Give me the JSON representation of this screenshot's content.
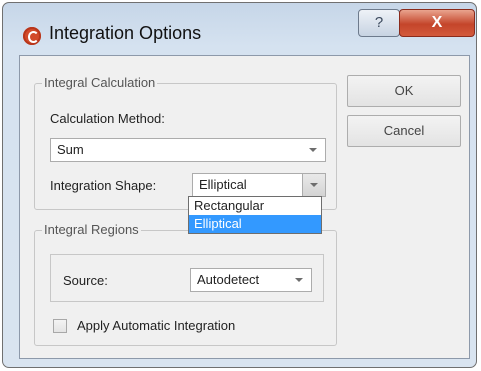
{
  "window": {
    "title": "Integration Options",
    "help_glyph": "?",
    "close_glyph": "X"
  },
  "integral_calculation": {
    "legend": "Integral Calculation",
    "method_label": "Calculation Method:",
    "method_value": "Sum",
    "shape_label": "Integration Shape:",
    "shape_value": "Elliptical",
    "shape_options": [
      "Rectangular",
      "Elliptical"
    ],
    "shape_selected_index": 1
  },
  "integral_regions": {
    "legend": "Integral Regions",
    "source_label": "Source:",
    "source_value": "Autodetect",
    "auto_integration_label": "Apply Automatic Integration",
    "auto_integration_checked": false
  },
  "buttons": {
    "ok": "OK",
    "cancel": "Cancel"
  },
  "icons": {
    "app": "app-logo-icon",
    "help": "help-icon",
    "close": "close-icon",
    "dropdown": "chevron-down-icon"
  },
  "colors": {
    "close_button": "#c4452a",
    "selection": "#3399ff",
    "title_bar": "#d5e2f0"
  }
}
